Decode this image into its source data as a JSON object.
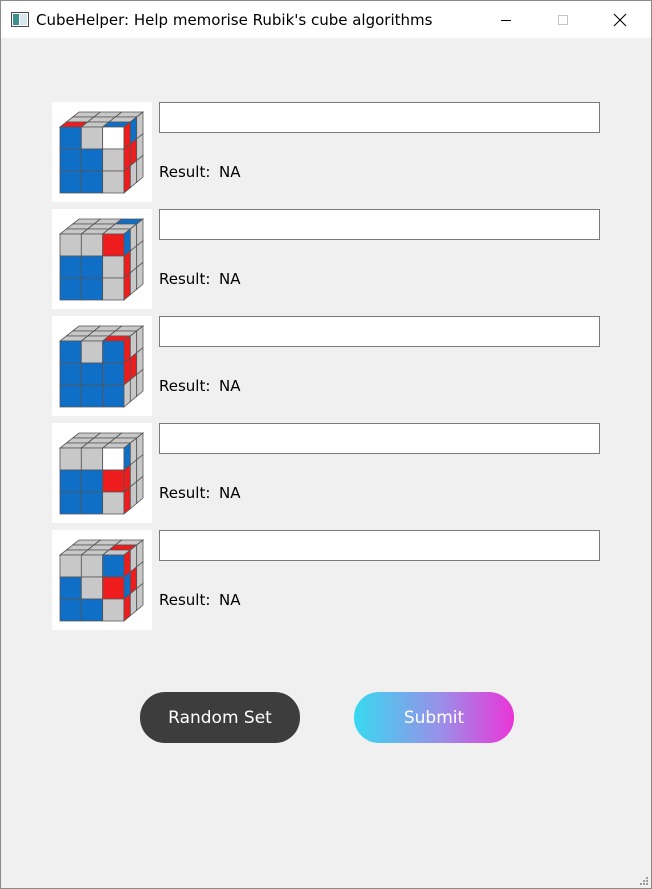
{
  "window": {
    "title": "CubeHelper: Help memorise Rubik's cube algorithms"
  },
  "cases": [
    {
      "image": "cube-case-1",
      "input_value": "",
      "result_label": "Result:",
      "result_value": "NA"
    },
    {
      "image": "cube-case-2",
      "input_value": "",
      "result_label": "Result:",
      "result_value": "NA"
    },
    {
      "image": "cube-case-3",
      "input_value": "",
      "result_label": "Result:",
      "result_value": "NA"
    },
    {
      "image": "cube-case-4",
      "input_value": "",
      "result_label": "Result:",
      "result_value": "NA"
    },
    {
      "image": "cube-case-5",
      "input_value": "",
      "result_label": "Result:",
      "result_value": "NA"
    }
  ],
  "buttons": {
    "random_label": "Random Set",
    "submit_label": "Submit"
  },
  "colors": {
    "cube_gray": "#c8c8c8",
    "cube_blue": "#0f6fc6",
    "cube_red": "#ee1c1c",
    "cube_white": "#ffffff",
    "random_button": "#3d3d3d",
    "submit_gradient_start": "#38d9f0",
    "submit_gradient_end": "#ea35d8"
  }
}
